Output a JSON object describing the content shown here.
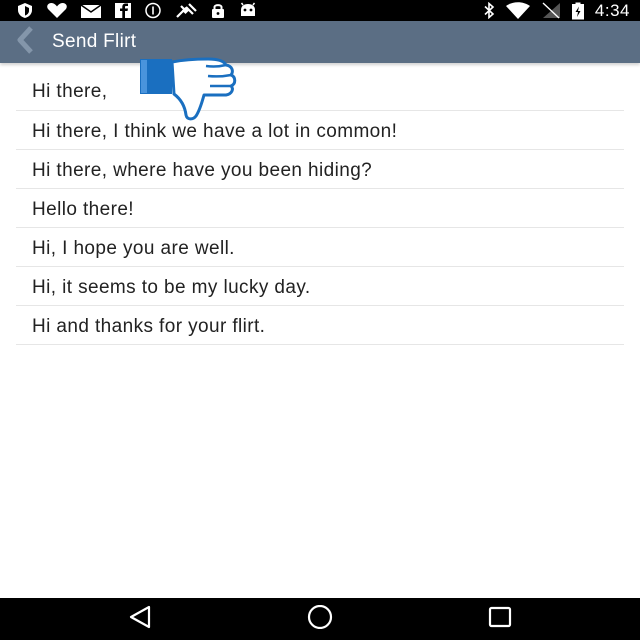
{
  "status_bar": {
    "time": "4:34",
    "left_icons": [
      "shield-icon",
      "heart-icon",
      "mail-icon",
      "facebook-icon",
      "info-icon",
      "satellite-icon",
      "lock-icon",
      "android-icon"
    ],
    "right_icons": [
      "bluetooth-icon",
      "wifi-icon",
      "signal-icon",
      "battery-icon"
    ]
  },
  "toolbar": {
    "title": "Send Flirt",
    "background": "#5b6e84"
  },
  "messages": [
    "Hi there,",
    "Hi there, I think we have a lot in common!",
    "Hi there, where have you been hiding?",
    "Hello there!",
    "Hi, I hope you are well.",
    "Hi, it seems to be my lucky day.",
    "Hi and thanks for your flirt."
  ],
  "overlay": {
    "icon": "thumbs-down-icon",
    "color": "#1a6fc0"
  },
  "nav_bar": {
    "buttons": [
      "back-triangle-icon",
      "home-circle-icon",
      "recents-square-icon"
    ]
  }
}
